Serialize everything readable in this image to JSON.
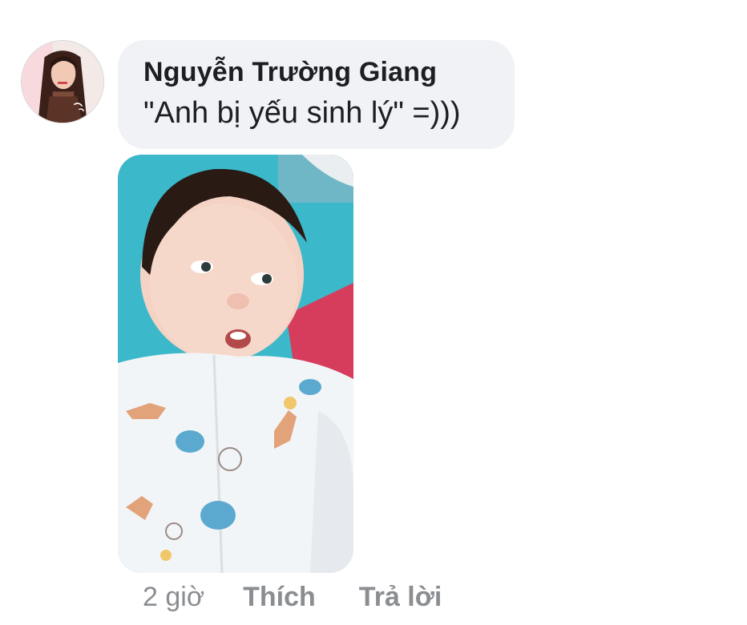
{
  "comment": {
    "author": "Nguyễn Trường Giang",
    "text": "\"Anh bị yếu sinh lý\" =)))",
    "timestamp": "2 giờ",
    "actions": {
      "like_label": "Thích",
      "reply_label": "Trả lời"
    },
    "attachment": {
      "kind": "photo"
    }
  },
  "colors": {
    "bubble_background": "#f0f2f5",
    "text": "#1c1e21",
    "secondary_text": "#8a8d91",
    "page_background": "#ffffff"
  }
}
